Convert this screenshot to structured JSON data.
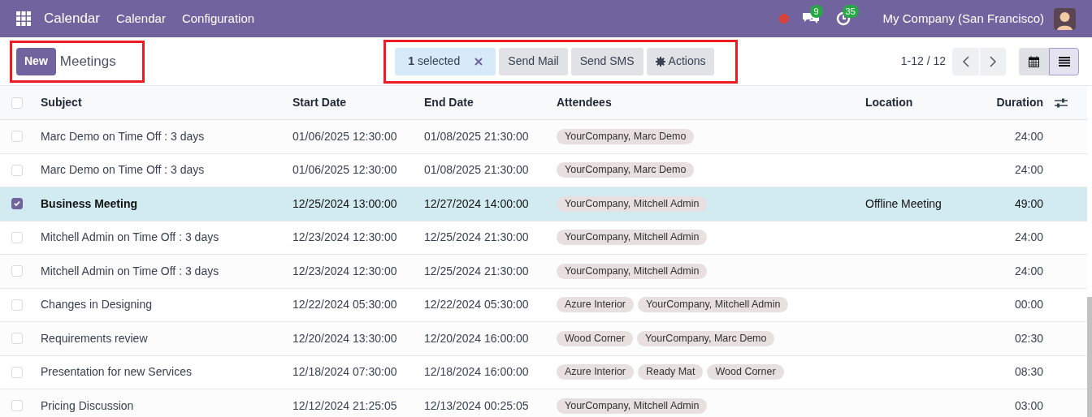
{
  "navbar": {
    "app_name": "Calendar",
    "menu": [
      "Calendar",
      "Configuration"
    ],
    "messages_count": "9",
    "activities_count": "35",
    "company": "My Company (San Francisco)"
  },
  "control_panel": {
    "new_button": "New",
    "breadcrumb": "Meetings",
    "selection": {
      "count": "1",
      "label": "selected"
    },
    "actions": [
      "Send Mail",
      "Send SMS",
      "Actions"
    ],
    "pager": "1-12 / 12",
    "views": [
      {
        "kind": "calendar",
        "selected": false
      },
      {
        "kind": "list",
        "selected": true
      }
    ]
  },
  "table": {
    "select_all_checked": false,
    "columns": [
      "Subject",
      "Start Date",
      "End Date",
      "Attendees",
      "Location",
      "Duration"
    ],
    "rows": [
      {
        "subject": "Marc Demo on Time Off : 3 days",
        "start": "01/06/2025 12:30:00",
        "end": "01/08/2025 21:30:00",
        "attendees": [
          "YourCompany, Marc Demo"
        ],
        "duration": "24:00",
        "selected": false
      },
      {
        "subject": "Marc Demo on Time Off : 3 days",
        "start": "01/06/2025 12:30:00",
        "end": "01/08/2025 21:30:00",
        "attendees": [
          "YourCompany, Marc Demo"
        ],
        "duration": "24:00",
        "selected": false
      },
      {
        "subject": "Business Meeting",
        "start": "12/25/2024 13:00:00",
        "end": "12/27/2024 14:00:00",
        "attendees": [
          "YourCompany, Mitchell Admin"
        ],
        "location": "Offline Meeting",
        "duration": "49:00",
        "selected": true
      },
      {
        "subject": "Mitchell Admin on Time Off : 3 days",
        "start": "12/23/2024 12:30:00",
        "end": "12/25/2024 21:30:00",
        "attendees": [
          "YourCompany, Mitchell Admin"
        ],
        "duration": "24:00",
        "selected": false
      },
      {
        "subject": "Mitchell Admin on Time Off : 3 days",
        "start": "12/23/2024 12:30:00",
        "end": "12/25/2024 21:30:00",
        "attendees": [
          "YourCompany, Mitchell Admin"
        ],
        "duration": "24:00",
        "selected": false
      },
      {
        "subject": "Changes in Designing",
        "start": "12/22/2024 05:30:00",
        "end": "12/22/2024 05:30:00",
        "attendees": [
          "Azure Interior",
          "YourCompany, Mitchell Admin"
        ],
        "duration": "00:00",
        "selected": false
      },
      {
        "subject": "Requirements review",
        "start": "12/20/2024 13:30:00",
        "end": "12/20/2024 16:00:00",
        "attendees": [
          "Wood Corner",
          "YourCompany, Marc Demo"
        ],
        "duration": "02:30",
        "selected": false
      },
      {
        "subject": "Presentation for new Services",
        "start": "12/18/2024 07:30:00",
        "end": "12/18/2024 16:00:00",
        "attendees": [
          "Azure Interior",
          "Ready Mat",
          "Wood Corner"
        ],
        "duration": "08:30",
        "selected": false
      },
      {
        "subject": "Pricing Discussion",
        "start": "12/12/2024 21:25:05",
        "end": "12/13/2024 00:25:05",
        "attendees": [
          "YourCompany, Mitchell Admin"
        ],
        "duration": "03:00",
        "selected": false
      }
    ]
  }
}
